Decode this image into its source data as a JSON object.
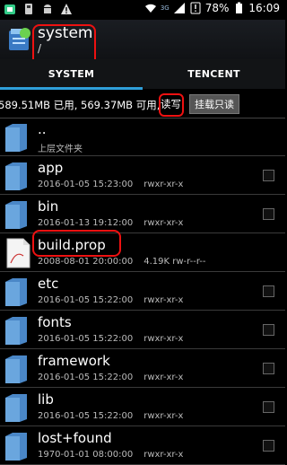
{
  "status_bar": {
    "network_label": "3G",
    "battery": "78%",
    "time": "16:09"
  },
  "header": {
    "title": "system",
    "path": "/"
  },
  "tabs": [
    {
      "label": "SYSTEM",
      "selected": true
    },
    {
      "label": "TENCENT",
      "selected": false
    }
  ],
  "storage_bar": {
    "info": "589.51MB 已用, 569.37MB 可用,",
    "rw_toggle": "读写",
    "mount_button": "挂载只读"
  },
  "files": [
    {
      "name": "..",
      "detail": "上层文件夹",
      "type": "folder-up"
    },
    {
      "name": "app",
      "date": "2016-01-05 15:23:00",
      "size": "",
      "perm": "rwxr-xr-x",
      "type": "folder"
    },
    {
      "name": "bin",
      "date": "2016-01-13 19:12:00",
      "size": "",
      "perm": "rwxr-xr-x",
      "type": "folder"
    },
    {
      "name": "build.prop",
      "date": "2008-08-01 20:00:00",
      "size": "4.19K",
      "perm": "rw-r--r--",
      "type": "file"
    },
    {
      "name": "etc",
      "date": "2016-01-05 15:22:00",
      "size": "",
      "perm": "rwxr-xr-x",
      "type": "folder"
    },
    {
      "name": "fonts",
      "date": "2016-01-05 15:22:00",
      "size": "",
      "perm": "rwxr-xr-x",
      "type": "folder"
    },
    {
      "name": "framework",
      "date": "2016-01-05 15:22:00",
      "size": "",
      "perm": "rwxr-xr-x",
      "type": "folder"
    },
    {
      "name": "lib",
      "date": "2016-01-05 15:22:00",
      "size": "",
      "perm": "rwxr-xr-x",
      "type": "folder"
    },
    {
      "name": "lost+found",
      "date": "1970-01-01 08:00:00",
      "size": "",
      "perm": "rwxr-xr-x",
      "type": "folder"
    }
  ],
  "colors": {
    "accent": "#2f9fd9",
    "annotation": "#e11111",
    "folder": "#4a87c7"
  }
}
